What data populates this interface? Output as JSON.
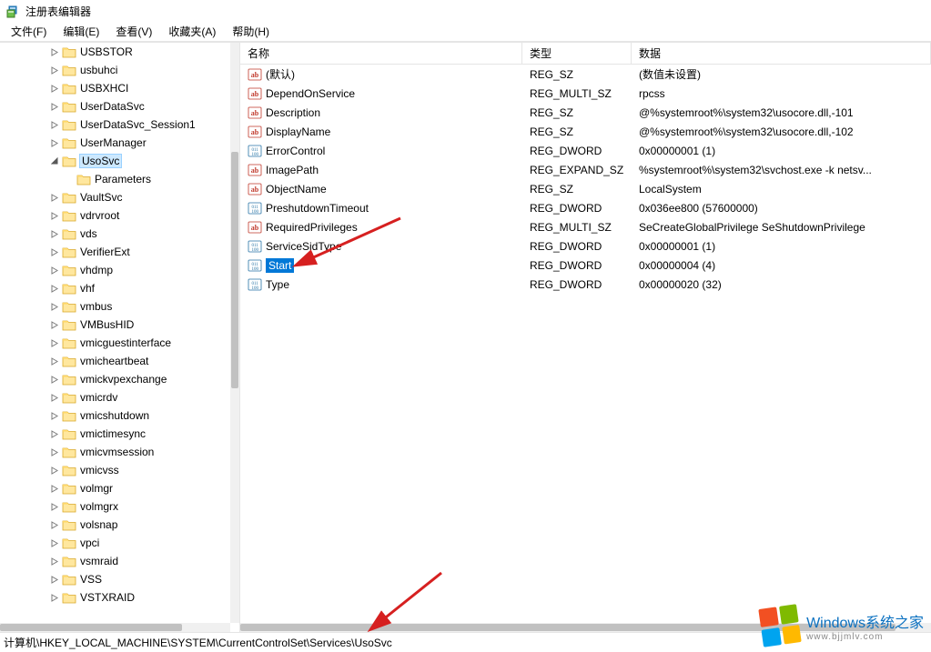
{
  "window": {
    "title": "注册表编辑器"
  },
  "menu": {
    "file": "文件(F)",
    "edit": "编辑(E)",
    "view": "查看(V)",
    "favorites": "收藏夹(A)",
    "help": "帮助(H)"
  },
  "tree": {
    "selected": "UsoSvc",
    "items": [
      {
        "indent": 5,
        "exp": "collapsed",
        "label": "USBSTOR"
      },
      {
        "indent": 5,
        "exp": "collapsed",
        "label": "usbuhci"
      },
      {
        "indent": 5,
        "exp": "collapsed",
        "label": "USBXHCI"
      },
      {
        "indent": 5,
        "exp": "collapsed",
        "label": "UserDataSvc"
      },
      {
        "indent": 5,
        "exp": "collapsed",
        "label": "UserDataSvc_Session1"
      },
      {
        "indent": 5,
        "exp": "collapsed",
        "label": "UserManager"
      },
      {
        "indent": 5,
        "exp": "expanded",
        "label": "UsoSvc",
        "selected": true
      },
      {
        "indent": 6,
        "exp": "none",
        "label": "Parameters"
      },
      {
        "indent": 5,
        "exp": "collapsed",
        "label": "VaultSvc"
      },
      {
        "indent": 5,
        "exp": "collapsed",
        "label": "vdrvroot"
      },
      {
        "indent": 5,
        "exp": "collapsed",
        "label": "vds"
      },
      {
        "indent": 5,
        "exp": "collapsed",
        "label": "VerifierExt"
      },
      {
        "indent": 5,
        "exp": "collapsed",
        "label": "vhdmp"
      },
      {
        "indent": 5,
        "exp": "collapsed",
        "label": "vhf"
      },
      {
        "indent": 5,
        "exp": "collapsed",
        "label": "vmbus"
      },
      {
        "indent": 5,
        "exp": "collapsed",
        "label": "VMBusHID"
      },
      {
        "indent": 5,
        "exp": "collapsed",
        "label": "vmicguestinterface"
      },
      {
        "indent": 5,
        "exp": "collapsed",
        "label": "vmicheartbeat"
      },
      {
        "indent": 5,
        "exp": "collapsed",
        "label": "vmickvpexchange"
      },
      {
        "indent": 5,
        "exp": "collapsed",
        "label": "vmicrdv"
      },
      {
        "indent": 5,
        "exp": "collapsed",
        "label": "vmicshutdown"
      },
      {
        "indent": 5,
        "exp": "collapsed",
        "label": "vmictimesync"
      },
      {
        "indent": 5,
        "exp": "collapsed",
        "label": "vmicvmsession"
      },
      {
        "indent": 5,
        "exp": "collapsed",
        "label": "vmicvss"
      },
      {
        "indent": 5,
        "exp": "collapsed",
        "label": "volmgr"
      },
      {
        "indent": 5,
        "exp": "collapsed",
        "label": "volmgrx"
      },
      {
        "indent": 5,
        "exp": "collapsed",
        "label": "volsnap"
      },
      {
        "indent": 5,
        "exp": "collapsed",
        "label": "vpci"
      },
      {
        "indent": 5,
        "exp": "collapsed",
        "label": "vsmraid"
      },
      {
        "indent": 5,
        "exp": "collapsed",
        "label": "VSS"
      },
      {
        "indent": 5,
        "exp": "collapsed",
        "label": "VSTXRAID"
      }
    ]
  },
  "list": {
    "columns": {
      "name": "名称",
      "type": "类型",
      "data": "数据"
    },
    "rows": [
      {
        "icon": "string",
        "name": "(默认)",
        "type": "REG_SZ",
        "data": "(数值未设置)"
      },
      {
        "icon": "string",
        "name": "DependOnService",
        "type": "REG_MULTI_SZ",
        "data": "rpcss"
      },
      {
        "icon": "string",
        "name": "Description",
        "type": "REG_SZ",
        "data": "@%systemroot%\\system32\\usocore.dll,-101"
      },
      {
        "icon": "string",
        "name": "DisplayName",
        "type": "REG_SZ",
        "data": "@%systemroot%\\system32\\usocore.dll,-102"
      },
      {
        "icon": "binary",
        "name": "ErrorControl",
        "type": "REG_DWORD",
        "data": "0x00000001 (1)"
      },
      {
        "icon": "string",
        "name": "ImagePath",
        "type": "REG_EXPAND_SZ",
        "data": "%systemroot%\\system32\\svchost.exe -k netsv..."
      },
      {
        "icon": "string",
        "name": "ObjectName",
        "type": "REG_SZ",
        "data": "LocalSystem"
      },
      {
        "icon": "binary",
        "name": "PreshutdownTimeout",
        "type": "REG_DWORD",
        "data": "0x036ee800 (57600000)"
      },
      {
        "icon": "string",
        "name": "RequiredPrivileges",
        "type": "REG_MULTI_SZ",
        "data": "SeCreateGlobalPrivilege SeShutdownPrivilege"
      },
      {
        "icon": "binary",
        "name": "ServiceSidType",
        "type": "REG_DWORD",
        "data": "0x00000001 (1)"
      },
      {
        "icon": "binary",
        "name": "Start",
        "type": "REG_DWORD",
        "data": "0x00000004 (4)",
        "selected": true
      },
      {
        "icon": "binary",
        "name": "Type",
        "type": "REG_DWORD",
        "data": "0x00000020 (32)"
      }
    ]
  },
  "statusbar": {
    "path": "计算机\\HKEY_LOCAL_MACHINE\\SYSTEM\\CurrentControlSet\\Services\\UsoSvc"
  },
  "watermark": {
    "line1": "Windows系统之家",
    "line2": "www.bjjmlv.com"
  }
}
